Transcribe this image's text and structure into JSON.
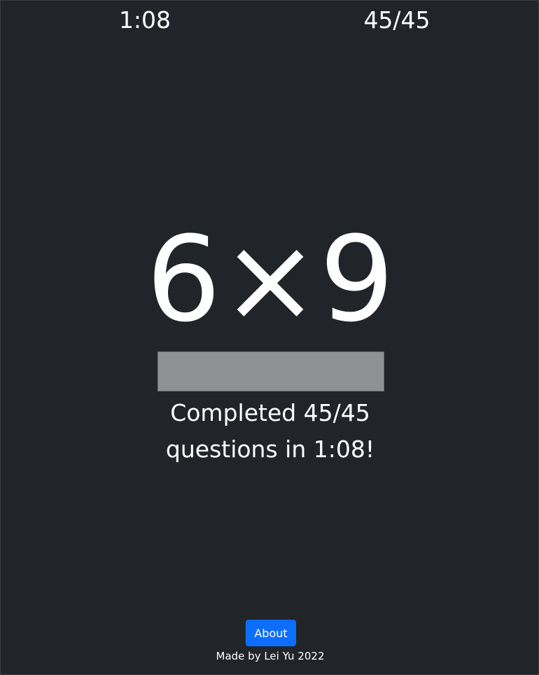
{
  "header": {
    "timer": "1:08",
    "progress": "45/45"
  },
  "quiz": {
    "problem": "6×9",
    "answer_value": "",
    "message_line1": "Completed 45/45",
    "message_line2": "questions in 1:08!"
  },
  "footer": {
    "about_label": "About",
    "credit": "Made by Lei Yu 2022"
  },
  "colors": {
    "background": "#212529",
    "text": "#ffffff",
    "input_disabled": "#8f9092",
    "accent": "#0d6efd"
  }
}
